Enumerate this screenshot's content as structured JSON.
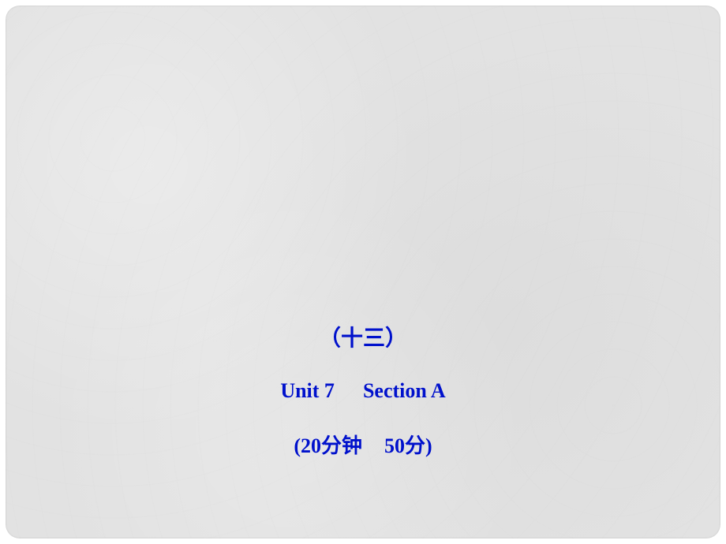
{
  "slide": {
    "number_label": "（十三）",
    "unit_label": "Unit 7",
    "section_label": "Section A",
    "time_label": "(20分钟",
    "score_label": "50分)"
  }
}
